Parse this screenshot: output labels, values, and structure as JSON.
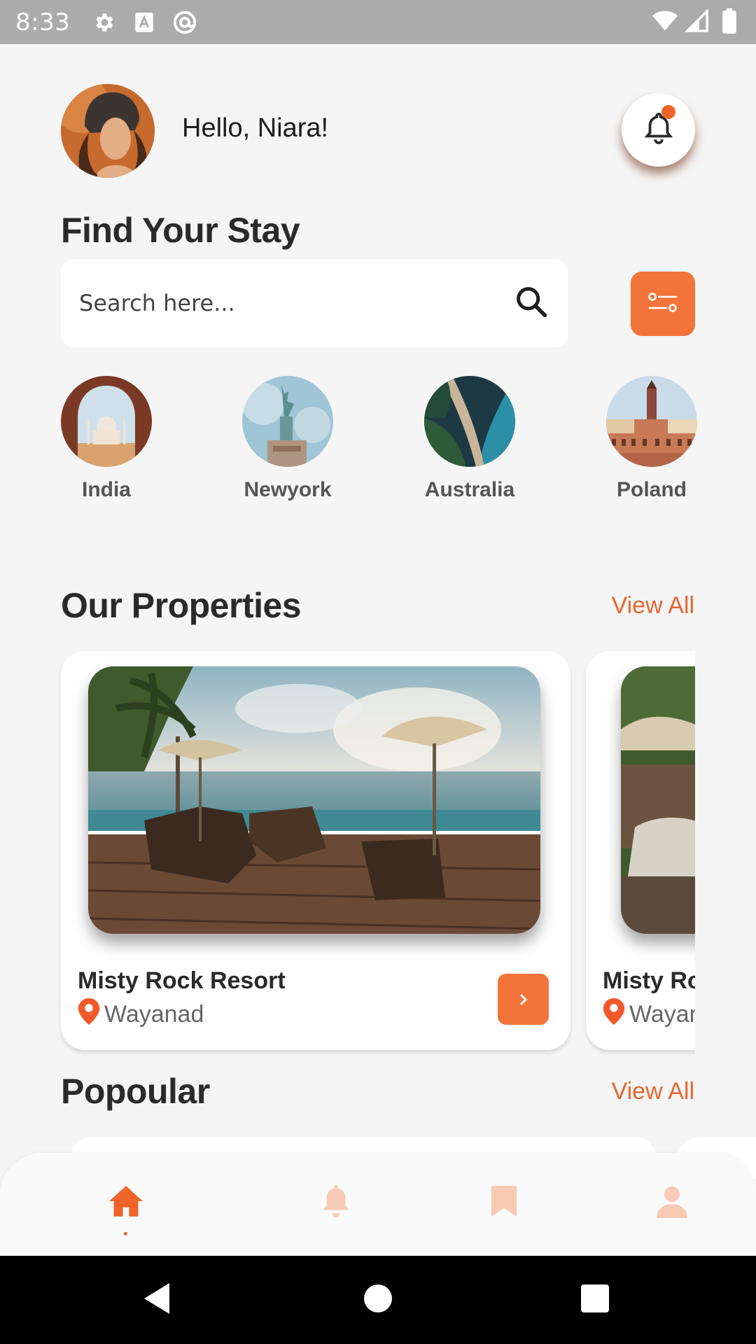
{
  "status_bar": {
    "time": "8:33",
    "icons_left": [
      "settings-icon",
      "font-icon",
      "at-sign-icon"
    ],
    "icons_right": [
      "wifi-icon",
      "signal-icon",
      "battery-icon"
    ]
  },
  "header": {
    "greeting": "Hello, Niara!",
    "notification_badge": true
  },
  "find": {
    "title": "Find Your Stay",
    "search_placeholder": "Search here..."
  },
  "destinations": [
    {
      "label": "India"
    },
    {
      "label": "Newyork"
    },
    {
      "label": "Australia"
    },
    {
      "label": "Poland"
    }
  ],
  "properties": {
    "title": "Our Properties",
    "view_all": "View All",
    "cards": [
      {
        "name": "Misty Rock Resort",
        "location": "Wayanad"
      },
      {
        "name": "Misty Rock Resort",
        "location": "Wayanad"
      }
    ]
  },
  "popular": {
    "title": "Popoular",
    "view_all": "View All"
  },
  "bottom_nav": {
    "items": [
      "home-icon",
      "bell-icon",
      "bookmark-icon",
      "profile-icon"
    ],
    "active": "home-icon"
  },
  "colors": {
    "accent": "#f3743b",
    "accent_text": "#e8652f",
    "nav_inactive": "#f8c9b3",
    "background": "#f5f5f5"
  }
}
